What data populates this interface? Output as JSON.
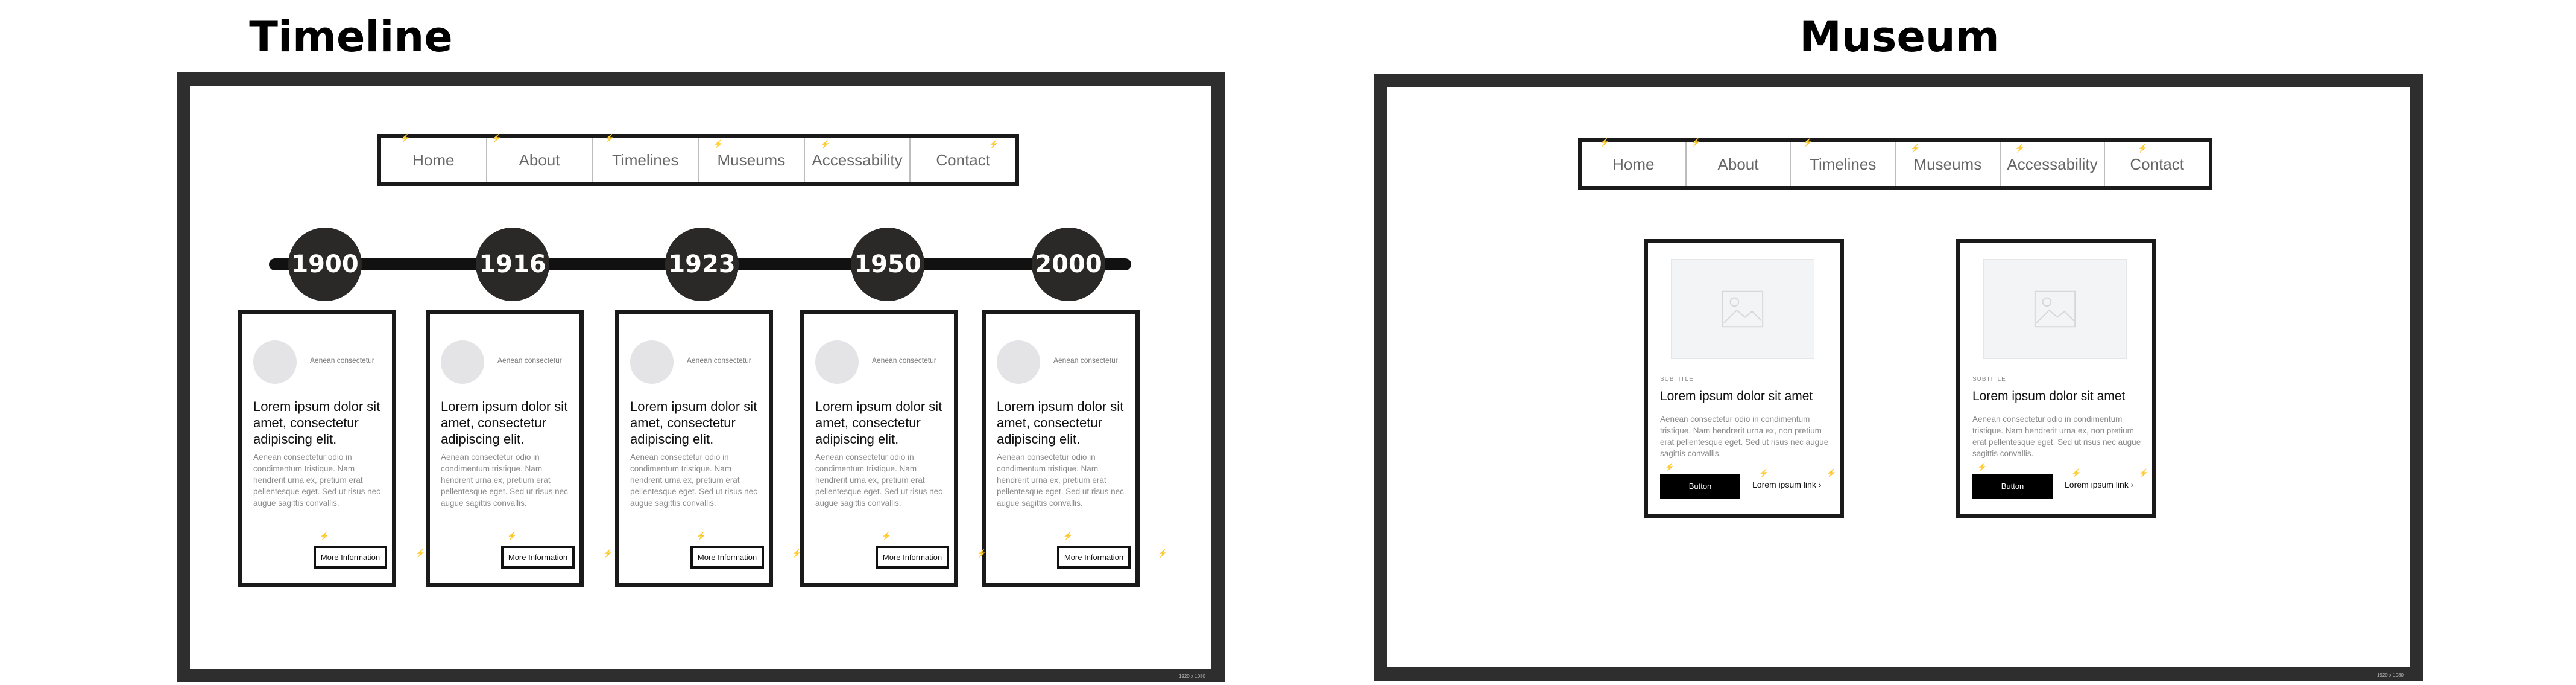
{
  "timeline": {
    "title": "Timeline",
    "nav": [
      "Home",
      "About",
      "Timelines",
      "Museums",
      "Accessability",
      "Contact"
    ],
    "years": [
      "1900",
      "1916",
      "1923",
      "1950",
      "2000"
    ],
    "cards": [
      {
        "subtitle": "Aenean consectetur",
        "heading": "Lorem ipsum dolor sit amet, consectetur adipiscing elit.",
        "body": "Aenean consectetur odio in condimentum tristique. Nam hendrerit urna ex, pretium erat pellentesque eget. Sed ut risus nec augue sagittis convallis.",
        "button": "More Information"
      },
      {
        "subtitle": "Aenean consectetur",
        "heading": "Lorem ipsum dolor sit amet, consectetur adipiscing elit.",
        "body": "Aenean consectetur odio in condimentum tristique. Nam hendrerit urna ex, pretium erat pellentesque eget. Sed ut risus nec augue sagittis convallis.",
        "button": "More Information"
      },
      {
        "subtitle": "Aenean consectetur",
        "heading": "Lorem ipsum dolor sit amet, consectetur adipiscing elit.",
        "body": "Aenean consectetur odio in condimentum tristique. Nam hendrerit urna ex, pretium erat pellentesque eget. Sed ut risus nec augue sagittis convallis.",
        "button": "More Information"
      },
      {
        "subtitle": "Aenean consectetur",
        "heading": "Lorem ipsum dolor sit amet, consectetur adipiscing elit.",
        "body": "Aenean consectetur odio in condimentum tristique. Nam hendrerit urna ex, pretium erat pellentesque eget. Sed ut risus nec augue sagittis convallis.",
        "button": "More Information"
      },
      {
        "subtitle": "Aenean consectetur",
        "heading": "Lorem ipsum dolor sit amet, consectetur adipiscing elit.",
        "body": "Aenean consectetur odio in condimentum tristique. Nam hendrerit urna ex, pretium erat pellentesque eget. Sed ut risus nec augue sagittis convallis.",
        "button": "More Information"
      }
    ],
    "frame_tag": "1920 x 1080"
  },
  "museum": {
    "title": "Museum",
    "nav": [
      "Home",
      "About",
      "Timelines",
      "Museums",
      "Accessability",
      "Contact"
    ],
    "cards": [
      {
        "eyebrow": "SUBTITLE",
        "heading": "Lorem ipsum dolor sit amet",
        "body": "Aenean consectetur odio in condimentum tristique. Nam hendrerit urna ex, non pretium erat pellentesque eget. Sed ut risus nec augue sagittis convallis.",
        "button": "Button",
        "link": "Lorem ipsum link ›"
      },
      {
        "eyebrow": "SUBTITLE",
        "heading": "Lorem ipsum dolor sit amet",
        "body": "Aenean consectetur odio in condimentum tristique. Nam hendrerit urna ex, non pretium erat pellentesque eget. Sed ut risus nec augue sagittis convallis.",
        "button": "Button",
        "link": "Lorem ipsum link ›"
      }
    ],
    "frame_tag": "1920 x 1080"
  },
  "icons": {
    "image_placeholder": "image-placeholder-icon",
    "bolt": "lightning-bolt-icon"
  },
  "colors": {
    "frame": "#2f2e2f",
    "timeline_dot": "#2b2828",
    "button": "#000000"
  }
}
